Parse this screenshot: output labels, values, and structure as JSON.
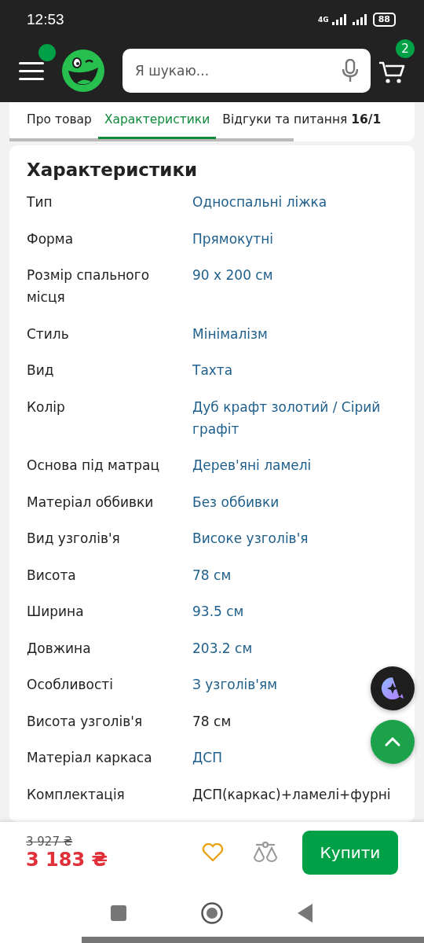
{
  "status_bar": {
    "time": "12:53",
    "network": "4G",
    "battery": "88"
  },
  "header": {
    "menu_badge": true,
    "search": {
      "placeholder": "Я шукаю..."
    },
    "cart_count": "2"
  },
  "tabs": [
    {
      "label": "Про товар",
      "selected": false
    },
    {
      "label": "Характеристики",
      "selected": true
    },
    {
      "label": "Відгуки та питання **16/1**",
      "selected": false
    }
  ],
  "specs": {
    "title": "Характеристики",
    "rows": [
      {
        "label": "Тип",
        "value": "Односпальні ліжка",
        "link": true
      },
      {
        "label": "Форма",
        "value": "Прямокутні",
        "link": true
      },
      {
        "label": "Розмір спального місця",
        "value": "90 x 200 см",
        "link": true
      },
      {
        "label": "Стиль",
        "value": "Мінімалізм",
        "link": true
      },
      {
        "label": "Вид",
        "value": "Тахта",
        "link": true
      },
      {
        "label": "Колір",
        "value": "Дуб крафт золотий / Сірий графіт",
        "link": true
      },
      {
        "label": "Основа під матрац",
        "value": "Дерев'яні ламелі",
        "link": true
      },
      {
        "label": "Матеріал оббивки",
        "value": "Без оббивки",
        "link": true
      },
      {
        "label": "Вид узголів'я",
        "value": "Високе узголів'я",
        "link": true
      },
      {
        "label": "Висота",
        "value": "78 см",
        "link": true
      },
      {
        "label": "Ширина",
        "value": "93.5 см",
        "link": true
      },
      {
        "label": "Довжина",
        "value": "203.2 см",
        "link": true
      },
      {
        "label": "Особливості",
        "value": "З узголів'ям",
        "link": true
      },
      {
        "label": "Висота узголів'я",
        "value": "78 см",
        "link": false
      },
      {
        "label": "Матеріал каркаса",
        "value": "ДСП",
        "link": true
      },
      {
        "label": "Комплектація",
        "value": "ДСП(каркас)+ламелі+фурні",
        "link": false
      }
    ]
  },
  "bottom_bar": {
    "old_price": "3 927 ₴",
    "price": "3 183 ₴",
    "favorite": false,
    "buy_button": "Купити"
  }
}
